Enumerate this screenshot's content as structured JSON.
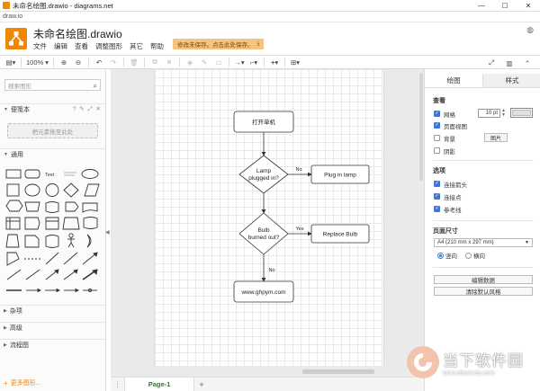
{
  "window": {
    "title": "未命名绘图.drawio - diagrams.net",
    "controls": {
      "minimize": "—",
      "maximize": "☐",
      "close": "✕"
    },
    "url": "draw.io"
  },
  "header": {
    "doc_title": "未命名绘图.drawio",
    "menu": [
      "文件",
      "编辑",
      "查看",
      "调整图形",
      "其它",
      "帮助"
    ],
    "save_notice": "修改未保存。点击此处保存。"
  },
  "toolbar": {
    "zoom": "100%"
  },
  "sidebar": {
    "search_placeholder": "搜索图形",
    "scratchpad_title": "便笺本",
    "scratchpad_tools": "? ✎ ⤢ ✕",
    "dropzone": "把元素拖至此处",
    "general_title": "通用",
    "shape_text_label": "Text",
    "sections": [
      "杂项",
      "高级",
      "流程图"
    ],
    "more_shapes": "更多图形..."
  },
  "diagram": {
    "nodes": {
      "start": "打开单机",
      "q1_line1": "Lamp",
      "q1_line2": "plugged in?",
      "plug": "Plug in lamp",
      "q2_line1": "Bulb",
      "q2_line2": "burned out?",
      "replace": "Replace Bulb",
      "end": "www.ghpym.com"
    },
    "edges": {
      "q1_no": "No",
      "q2_yes": "Yes",
      "q2_no": "No"
    }
  },
  "pagebar": {
    "menu": "⋮",
    "page_tab": "Page-1",
    "add": "+"
  },
  "right_panel": {
    "tabs": [
      "绘图",
      "样式"
    ],
    "view_title": "查看",
    "grid_label": "网格",
    "grid_size": "10 pt",
    "page_view_label": "页面视图",
    "background_label": "背景",
    "image_button": "图片",
    "shadow_label": "阴影",
    "options_title": "选项",
    "connection_arrows": "连接箭头",
    "connection_points": "连接点",
    "guides": "参考线",
    "paper_title": "页面尺寸",
    "paper_size": "A4 (210 mm x 297 mm)",
    "portrait": "竖向",
    "landscape": "横向",
    "edit_data": "编辑数据",
    "clear_style": "清除默认风格"
  },
  "watermark": {
    "title": "当下软件园",
    "url": "www.downxia.com"
  }
}
